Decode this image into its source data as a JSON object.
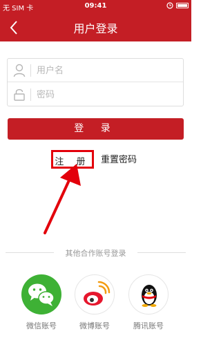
{
  "status_bar": {
    "carrier": "无 SIM 卡",
    "time": "09:41"
  },
  "nav": {
    "title": "用户登录",
    "back_icon": "chevron-left-icon"
  },
  "form": {
    "username_placeholder": "用户名",
    "password_placeholder": "密码",
    "username_icon": "user-icon",
    "password_icon": "lock-icon"
  },
  "login_button": "登 录",
  "links": {
    "register": "注 册",
    "reset_password": "重置密码"
  },
  "annotation": {
    "highlight_color": "#e3000b"
  },
  "other_login": {
    "title": "其他合作账号登录",
    "items": [
      {
        "label": "微信账号",
        "icon": "wechat-icon"
      },
      {
        "label": "微博账号",
        "icon": "weibo-icon"
      },
      {
        "label": "腾讯账号",
        "icon": "qq-icon"
      }
    ]
  },
  "colors": {
    "brand": "#c41e25",
    "wechat": "#3eb135"
  }
}
